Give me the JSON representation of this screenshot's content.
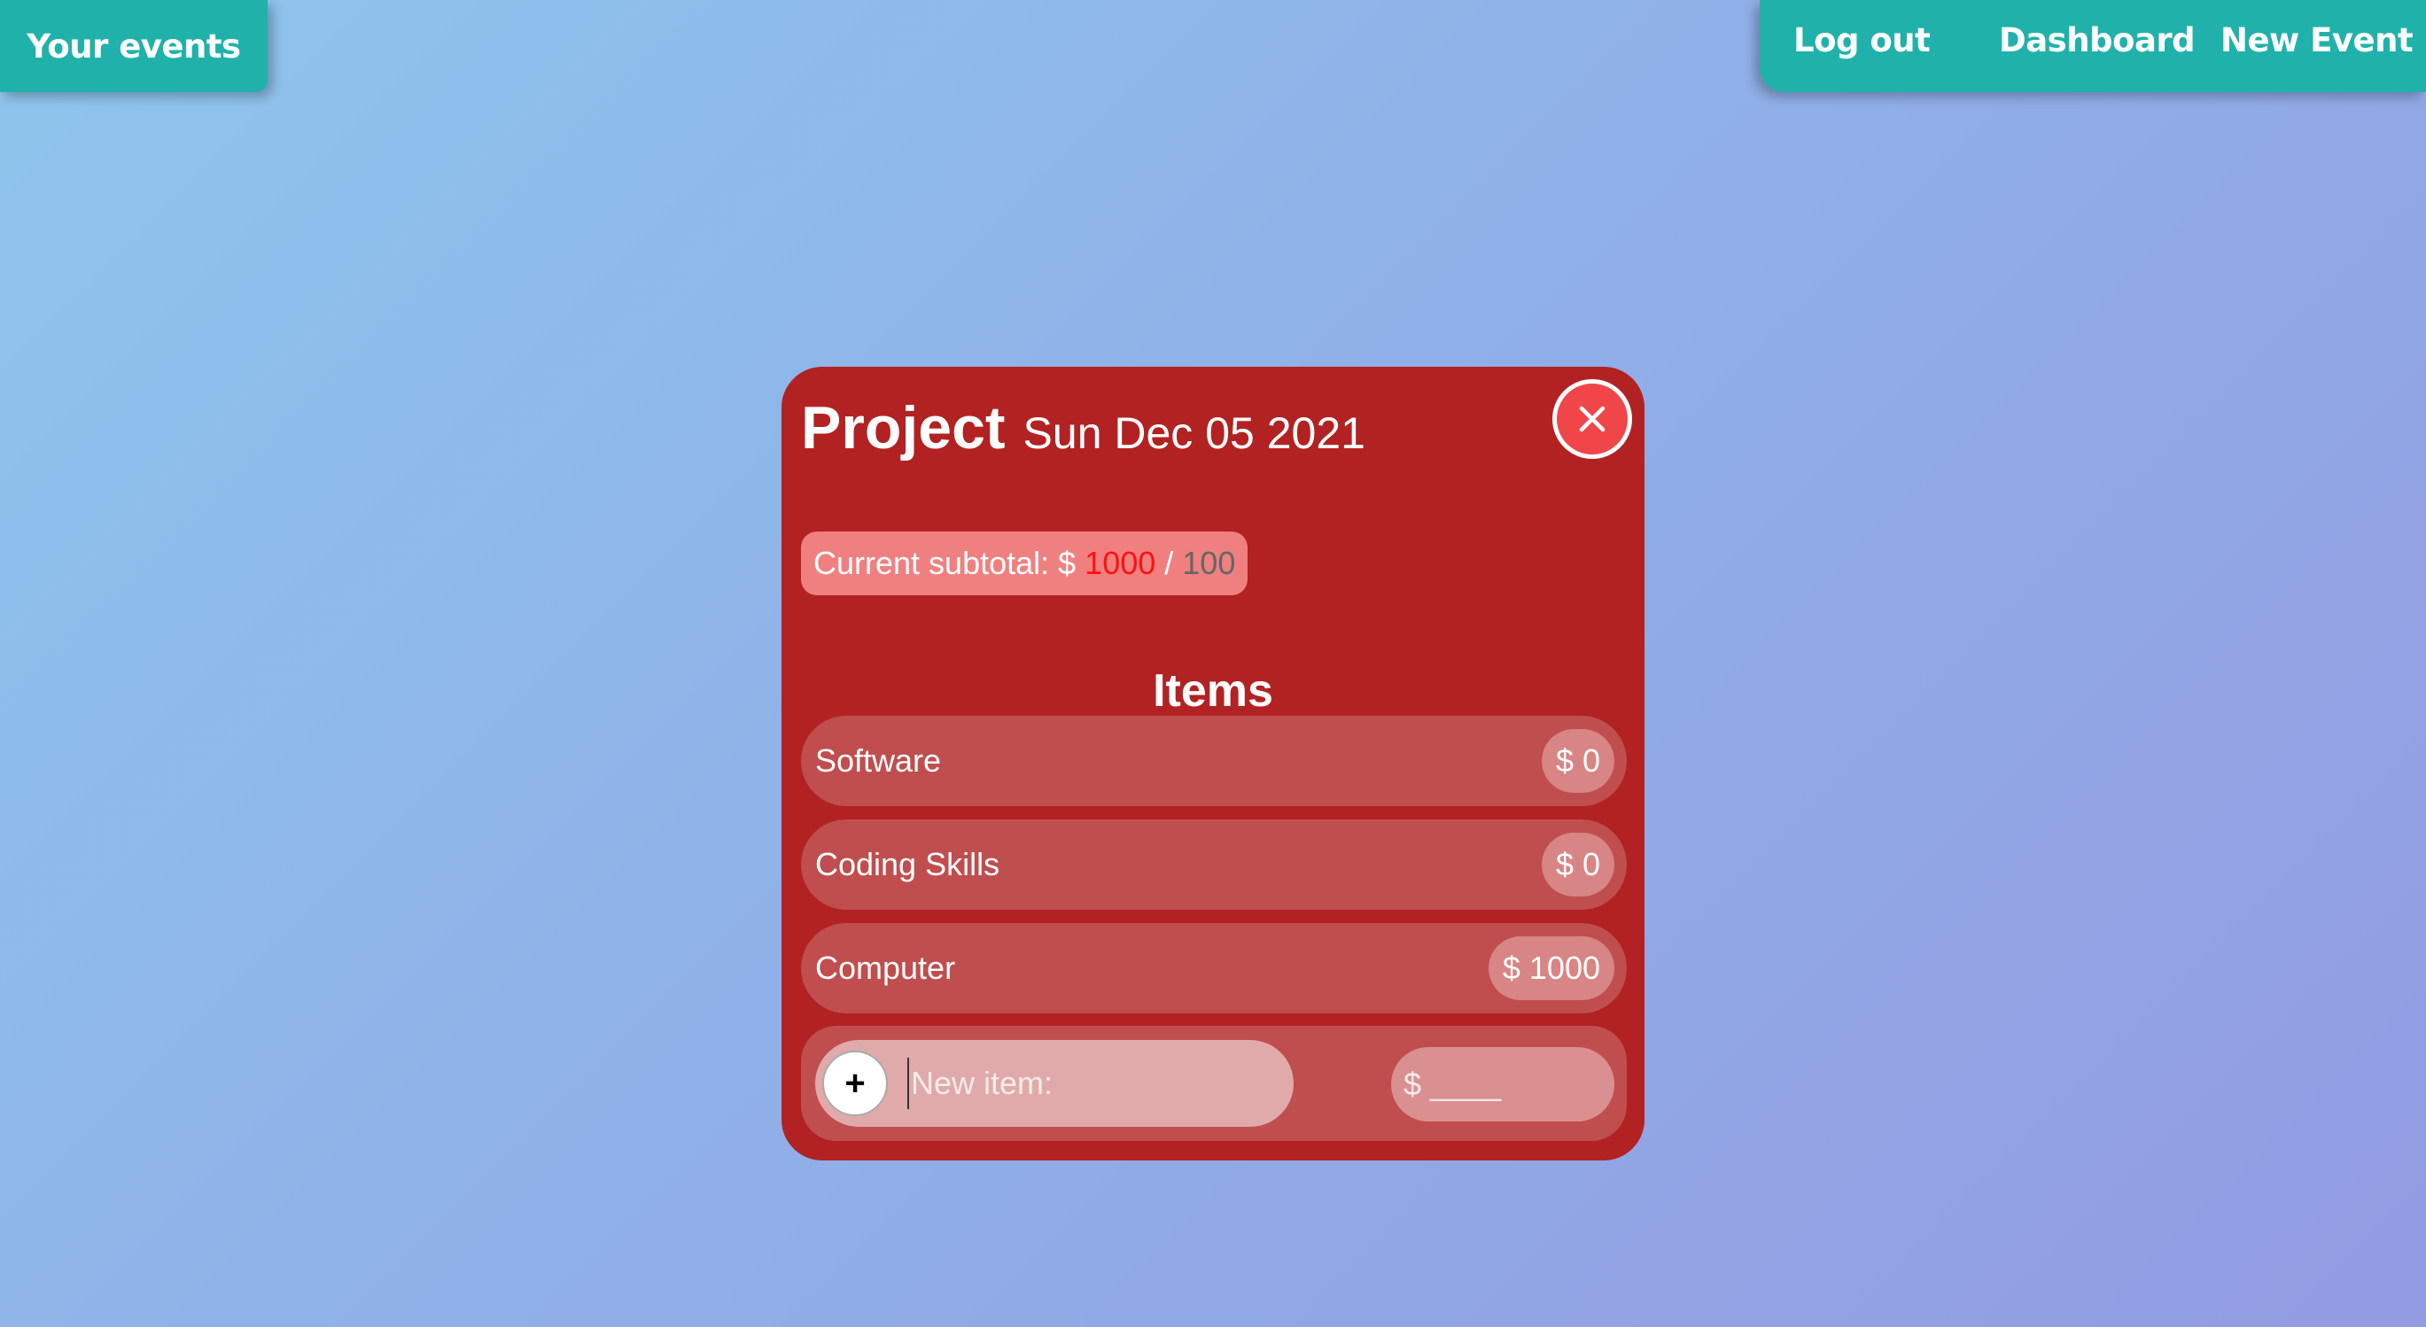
{
  "nav": {
    "left_label": "Your events",
    "right_links": [
      "Log out",
      "Dashboard",
      "New Event"
    ]
  },
  "modal": {
    "title": "Project",
    "date": "Sun Dec 05 2021",
    "close_icon": "close-icon",
    "subtotal": {
      "label": "Current subtotal: $",
      "current": "1000",
      "separator": "/",
      "goal": "100"
    },
    "items_heading": "Items",
    "items": [
      {
        "name": "Software",
        "price": "$ 0"
      },
      {
        "name": "Coding Skills",
        "price": "$ 0"
      },
      {
        "name": "Computer",
        "price": "$ 1000"
      }
    ],
    "new_item": {
      "add_icon": "plus-icon",
      "add_label": "+",
      "name_placeholder": "New item:",
      "price_placeholder": "$ ____"
    }
  },
  "colors": {
    "nav": "#20b2aa",
    "modal": "#b22222",
    "subtotal_bg": "#f08080",
    "subtotal_current": "#ff1111",
    "close_button": "#f0464a"
  }
}
